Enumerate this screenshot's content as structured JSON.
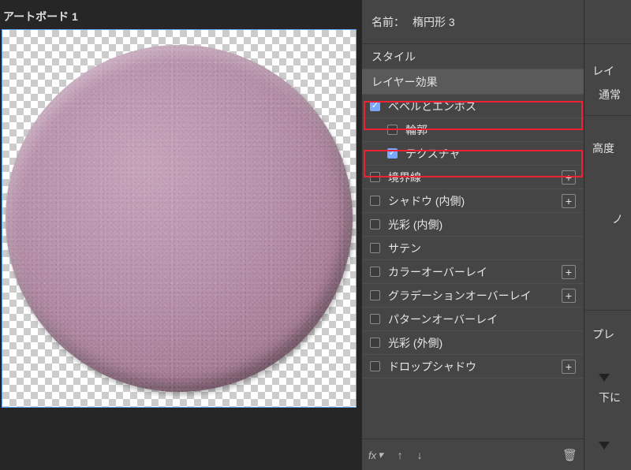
{
  "artboard_label": "アートボード 1",
  "name_row": {
    "label": "名前：",
    "value": "楕円形 3"
  },
  "styles": {
    "header": "スタイル",
    "effect": "レイヤー効果",
    "items": [
      {
        "id": "bevel",
        "label": "ベベルとエンボス",
        "checked": true,
        "indent": 1,
        "plus": false
      },
      {
        "id": "contour",
        "label": "輪郭",
        "checked": false,
        "indent": 2,
        "plus": false
      },
      {
        "id": "texture",
        "label": "テクスチャ",
        "checked": true,
        "indent": 2,
        "plus": false
      },
      {
        "id": "stroke",
        "label": "境界線",
        "checked": false,
        "indent": 1,
        "plus": true
      },
      {
        "id": "ishadow",
        "label": "シャドウ (内側)",
        "checked": false,
        "indent": 1,
        "plus": true
      },
      {
        "id": "iglow",
        "label": "光彩 (内側)",
        "checked": false,
        "indent": 1,
        "plus": false
      },
      {
        "id": "satin",
        "label": "サテン",
        "checked": false,
        "indent": 1,
        "plus": false
      },
      {
        "id": "coverlay",
        "label": "カラーオーバーレイ",
        "checked": false,
        "indent": 1,
        "plus": true
      },
      {
        "id": "goverlay",
        "label": "グラデーションオーバーレイ",
        "checked": false,
        "indent": 1,
        "plus": true
      },
      {
        "id": "poverlay",
        "label": "パターンオーバーレイ",
        "checked": false,
        "indent": 1,
        "plus": false
      },
      {
        "id": "oglow",
        "label": "光彩 (外側)",
        "checked": false,
        "indent": 1,
        "plus": false
      },
      {
        "id": "dshadow",
        "label": "ドロップシャドウ",
        "checked": false,
        "indent": 1,
        "plus": true
      }
    ]
  },
  "right_titles": {
    "layer": "レイ",
    "normal": "通常",
    "height": "高度",
    "slash": "ノ",
    "preview": "プレ",
    "below": "下に"
  },
  "footer": {
    "fx": "fx",
    "up": "↑",
    "down": "↓",
    "trash": "🗑"
  }
}
